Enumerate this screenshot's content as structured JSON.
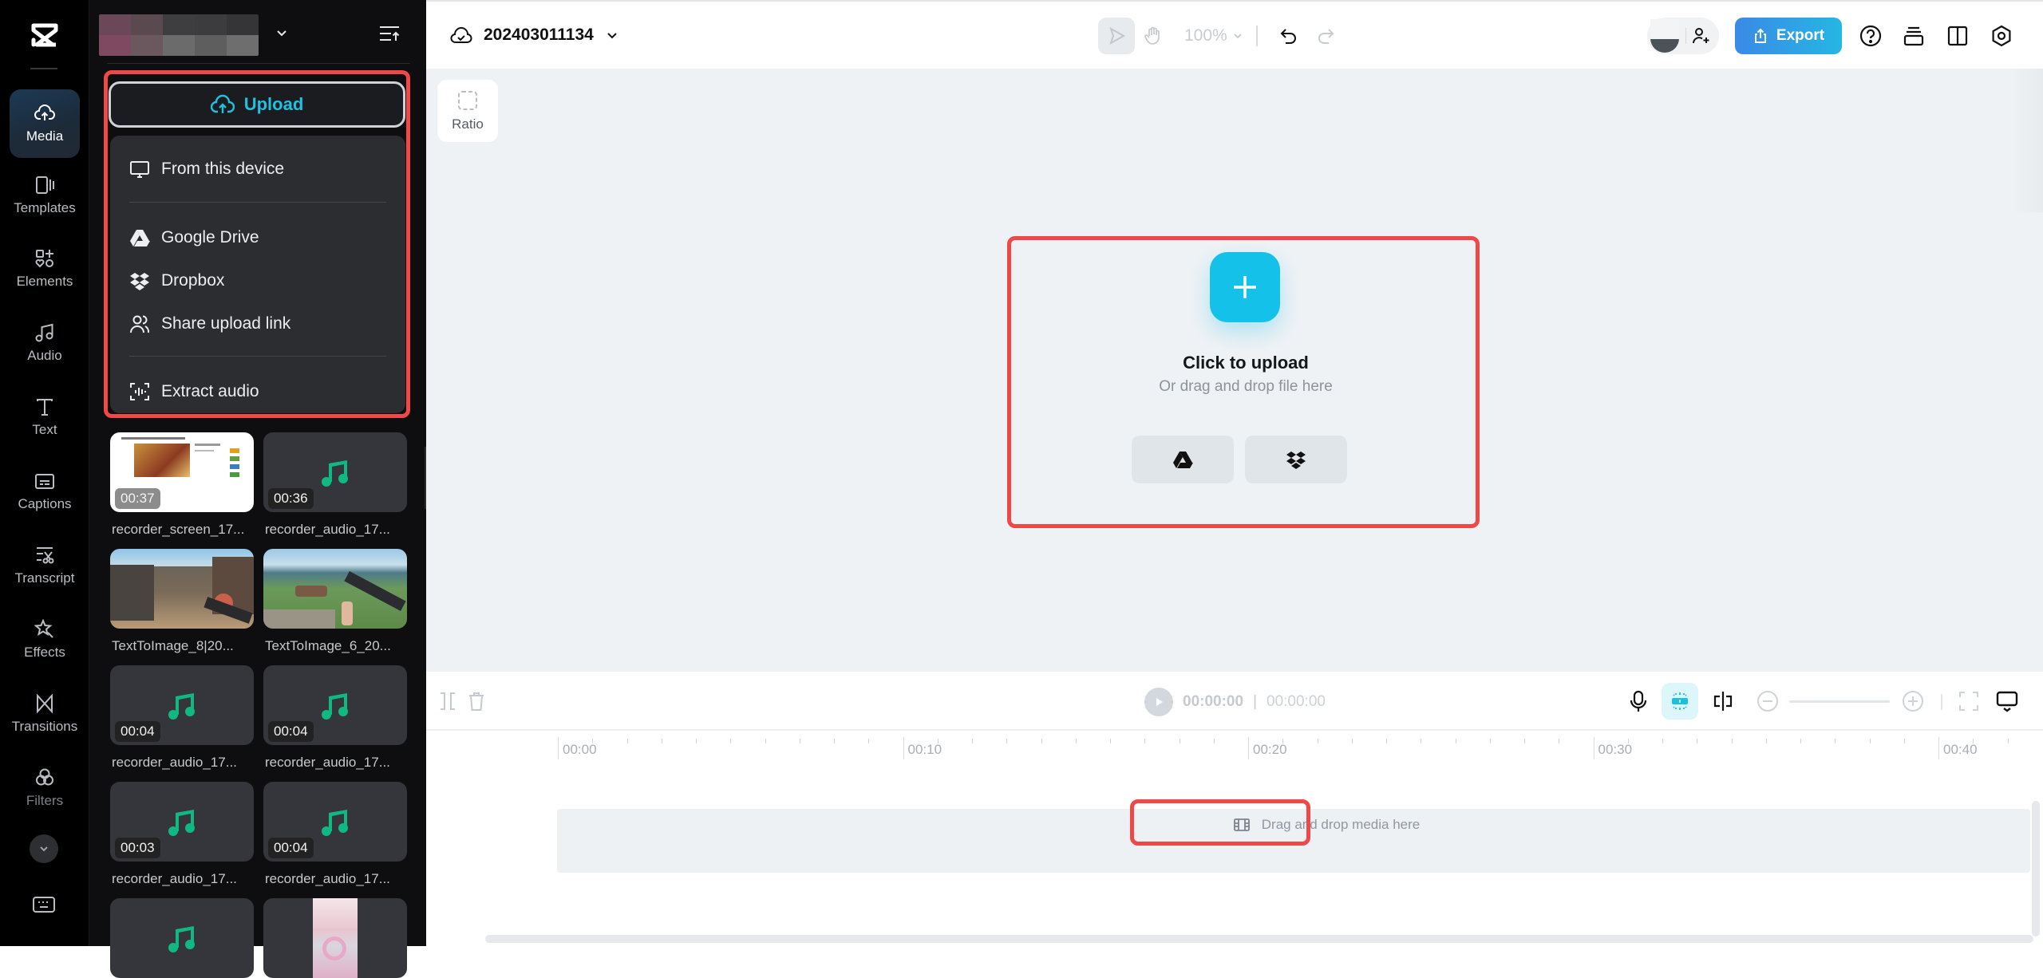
{
  "rail": {
    "items": [
      {
        "label": "Media",
        "icon": "cloud-upload-icon",
        "active": true
      },
      {
        "label": "Templates",
        "icon": "templates-icon"
      },
      {
        "label": "Elements",
        "icon": "elements-icon"
      },
      {
        "label": "Audio",
        "icon": "music-note-icon"
      },
      {
        "label": "Text",
        "icon": "text-icon"
      },
      {
        "label": "Captions",
        "icon": "captions-icon"
      },
      {
        "label": "Transcript",
        "icon": "transcript-icon"
      },
      {
        "label": "Effects",
        "icon": "effects-star-icon"
      },
      {
        "label": "Transitions",
        "icon": "transitions-icon"
      },
      {
        "label": "Filters",
        "icon": "filters-icon"
      }
    ]
  },
  "panel": {
    "upload_label": "Upload",
    "menu": [
      {
        "label": "From this device",
        "icon": "monitor-icon"
      },
      {
        "label": "Google Drive",
        "icon": "google-drive-icon"
      },
      {
        "label": "Dropbox",
        "icon": "dropbox-icon"
      },
      {
        "label": "Share upload link",
        "icon": "users-icon"
      },
      {
        "label": "Extract audio",
        "icon": "extract-audio-icon"
      }
    ],
    "media": [
      {
        "name": "recorder_screen_17...",
        "duration": "00:37",
        "type": "screen"
      },
      {
        "name": "recorder_audio_17...",
        "duration": "00:36",
        "type": "audio"
      },
      {
        "name": "TextToImage_8|20...",
        "duration": "",
        "type": "image-street"
      },
      {
        "name": "TextToImage_6_20...",
        "duration": "",
        "type": "image-valley"
      },
      {
        "name": "recorder_audio_17...",
        "duration": "00:04",
        "type": "audio"
      },
      {
        "name": "recorder_audio_17...",
        "duration": "00:04",
        "type": "audio"
      },
      {
        "name": "recorder_audio_17...",
        "duration": "00:03",
        "type": "audio"
      },
      {
        "name": "recorder_audio_17...",
        "duration": "00:04",
        "type": "audio"
      },
      {
        "name": "",
        "duration": "",
        "type": "audio"
      },
      {
        "name": "",
        "duration": "",
        "type": "image-flowers"
      }
    ]
  },
  "topbar": {
    "project_name": "202403011134",
    "zoom_level": "100%",
    "export_label": "Export"
  },
  "canvas": {
    "ratio_label": "Ratio",
    "upload_title": "Click to upload",
    "upload_subtitle": "Or drag and drop file here"
  },
  "timeline": {
    "current_time": "00:00:00",
    "separator": "|",
    "total_time": "00:00:00",
    "ruler_labels": [
      "00:00",
      "00:10",
      "00:20",
      "00:30",
      "00:40"
    ],
    "drop_label": "Drag and drop media here"
  },
  "colors": {
    "accent": "#14c1e8",
    "export_start": "#3a8ae6",
    "export_end": "#26b6e4",
    "audio_note": "#10b981",
    "highlight": "#f04848"
  }
}
